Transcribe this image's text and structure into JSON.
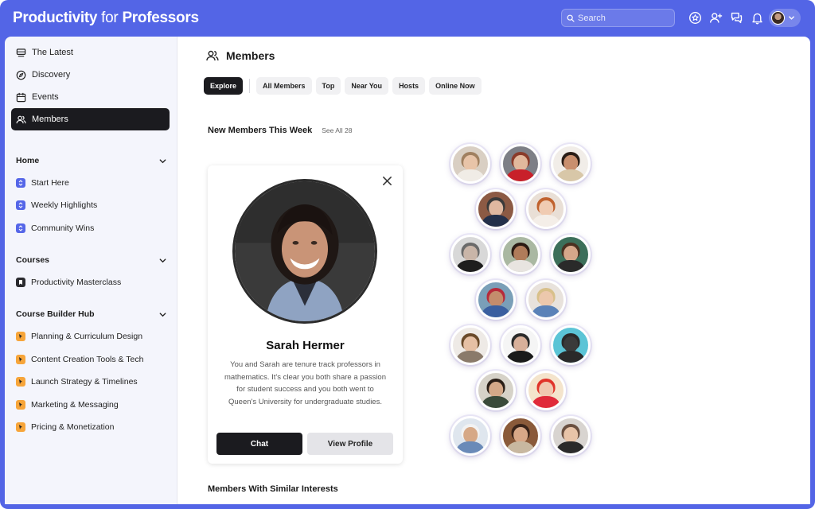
{
  "app": {
    "brand_part1": "Productivity",
    "brand_part2": " for ",
    "brand_part3": "Professors"
  },
  "search": {
    "placeholder": "Search"
  },
  "colors": {
    "accent": "#5365e6",
    "dark": "#1b1b1f",
    "orange": "#f7a53a"
  },
  "sidebar": {
    "nav": [
      {
        "label": "The Latest",
        "icon": "inbox-icon"
      },
      {
        "label": "Discovery",
        "icon": "compass-icon"
      },
      {
        "label": "Events",
        "icon": "calendar-icon"
      },
      {
        "label": "Members",
        "icon": "users-icon",
        "active": true
      }
    ],
    "sections": [
      {
        "title": "Home",
        "items": [
          {
            "label": "Start Here"
          },
          {
            "label": "Weekly Highlights"
          },
          {
            "label": "Community Wins"
          }
        ]
      },
      {
        "title": "Courses",
        "items": [
          {
            "label": "Productivity Masterclass"
          }
        ]
      },
      {
        "title": "Course Builder Hub",
        "items": [
          {
            "label": "Planning & Curriculum Design"
          },
          {
            "label": "Content Creation Tools & Tech"
          },
          {
            "label": "Launch Strategy & Timelines"
          },
          {
            "label": "Marketing & Messaging"
          },
          {
            "label": "Pricing & Monetization"
          }
        ]
      }
    ]
  },
  "main": {
    "title": "Members",
    "tabs": [
      "Explore",
      "All Members",
      "Top",
      "Near You",
      "Hosts",
      "Online Now"
    ],
    "new_members_title": "New Members This Week",
    "see_all": "See All 28",
    "similar_title": "Members With Similar Interests"
  },
  "profile_card": {
    "name": "Sarah Hermer",
    "description": "You and Sarah are tenure track professors in mathematics. It's clear you both share a passion for student success and you both went to Queen's University for undergraduate studies.",
    "chat_label": "Chat",
    "view_profile_label": "View Profile"
  }
}
